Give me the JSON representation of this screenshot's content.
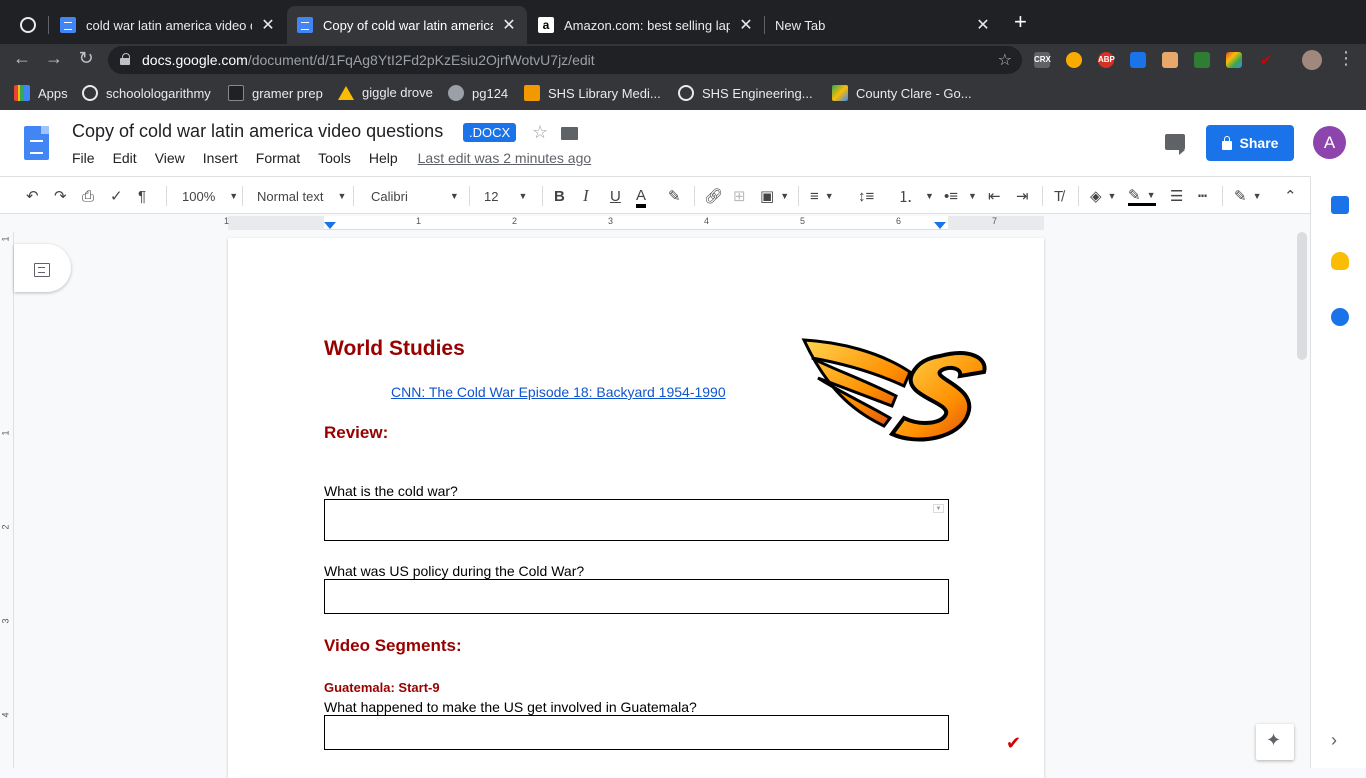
{
  "browser": {
    "tabs": [
      {
        "title": "cold war latin america video qu",
        "close": "✕"
      },
      {
        "title": "Copy of cold war latin america",
        "close": "✕"
      },
      {
        "title": "Amazon.com: best selling lapto",
        "close": "✕",
        "fav": "a"
      },
      {
        "title": "New Tab",
        "close": "✕"
      }
    ],
    "new_tab": "+",
    "url_host": "docs.google.com",
    "url_path": "/document/d/1FqAg8YtI2Fd2pKzEsiu2OjrfWotvU7jz/edit",
    "bookmarks": [
      "Apps",
      "schoolologarithmy",
      "gramer prep",
      "giggle drove",
      "pg124",
      "SHS Library Medi...",
      "SHS Engineering...",
      "County Clare - Go..."
    ],
    "extensions": [
      "CRX",
      "ABP"
    ]
  },
  "docs": {
    "title": "Copy of cold war latin america video questions",
    "badge": ".DOCX",
    "menu": [
      "File",
      "Edit",
      "View",
      "Insert",
      "Format",
      "Tools",
      "Help"
    ],
    "last_edit": "Last edit was 2 minutes ago",
    "share": "Share",
    "avatar_letter": "A",
    "accent": "#1a73e8"
  },
  "toolbar": {
    "zoom": "100%",
    "style": "Normal text",
    "font": "Calibri",
    "size": "12",
    "bold": "B",
    "italic": "I",
    "underline": "U",
    "text_color": "A"
  },
  "ruler": {
    "numbers": [
      "1",
      "1",
      "2",
      "3",
      "4",
      "5",
      "6",
      "7"
    ],
    "vnumbers": [
      "1",
      "1",
      "2",
      "3",
      "4"
    ]
  },
  "document": {
    "title": "World Studies",
    "link": "CNN: The Cold War Episode 18: Backyard 1954-1990",
    "review": "Review:",
    "q1": "What is the cold war?",
    "q2": "What was US policy during the Cold War?",
    "segments": "Video Segments:",
    "guatemala": "Guatemala: Start-9",
    "q3": "What happened to make the US get involved in Guatemala?",
    "heading_color": "#990000"
  }
}
